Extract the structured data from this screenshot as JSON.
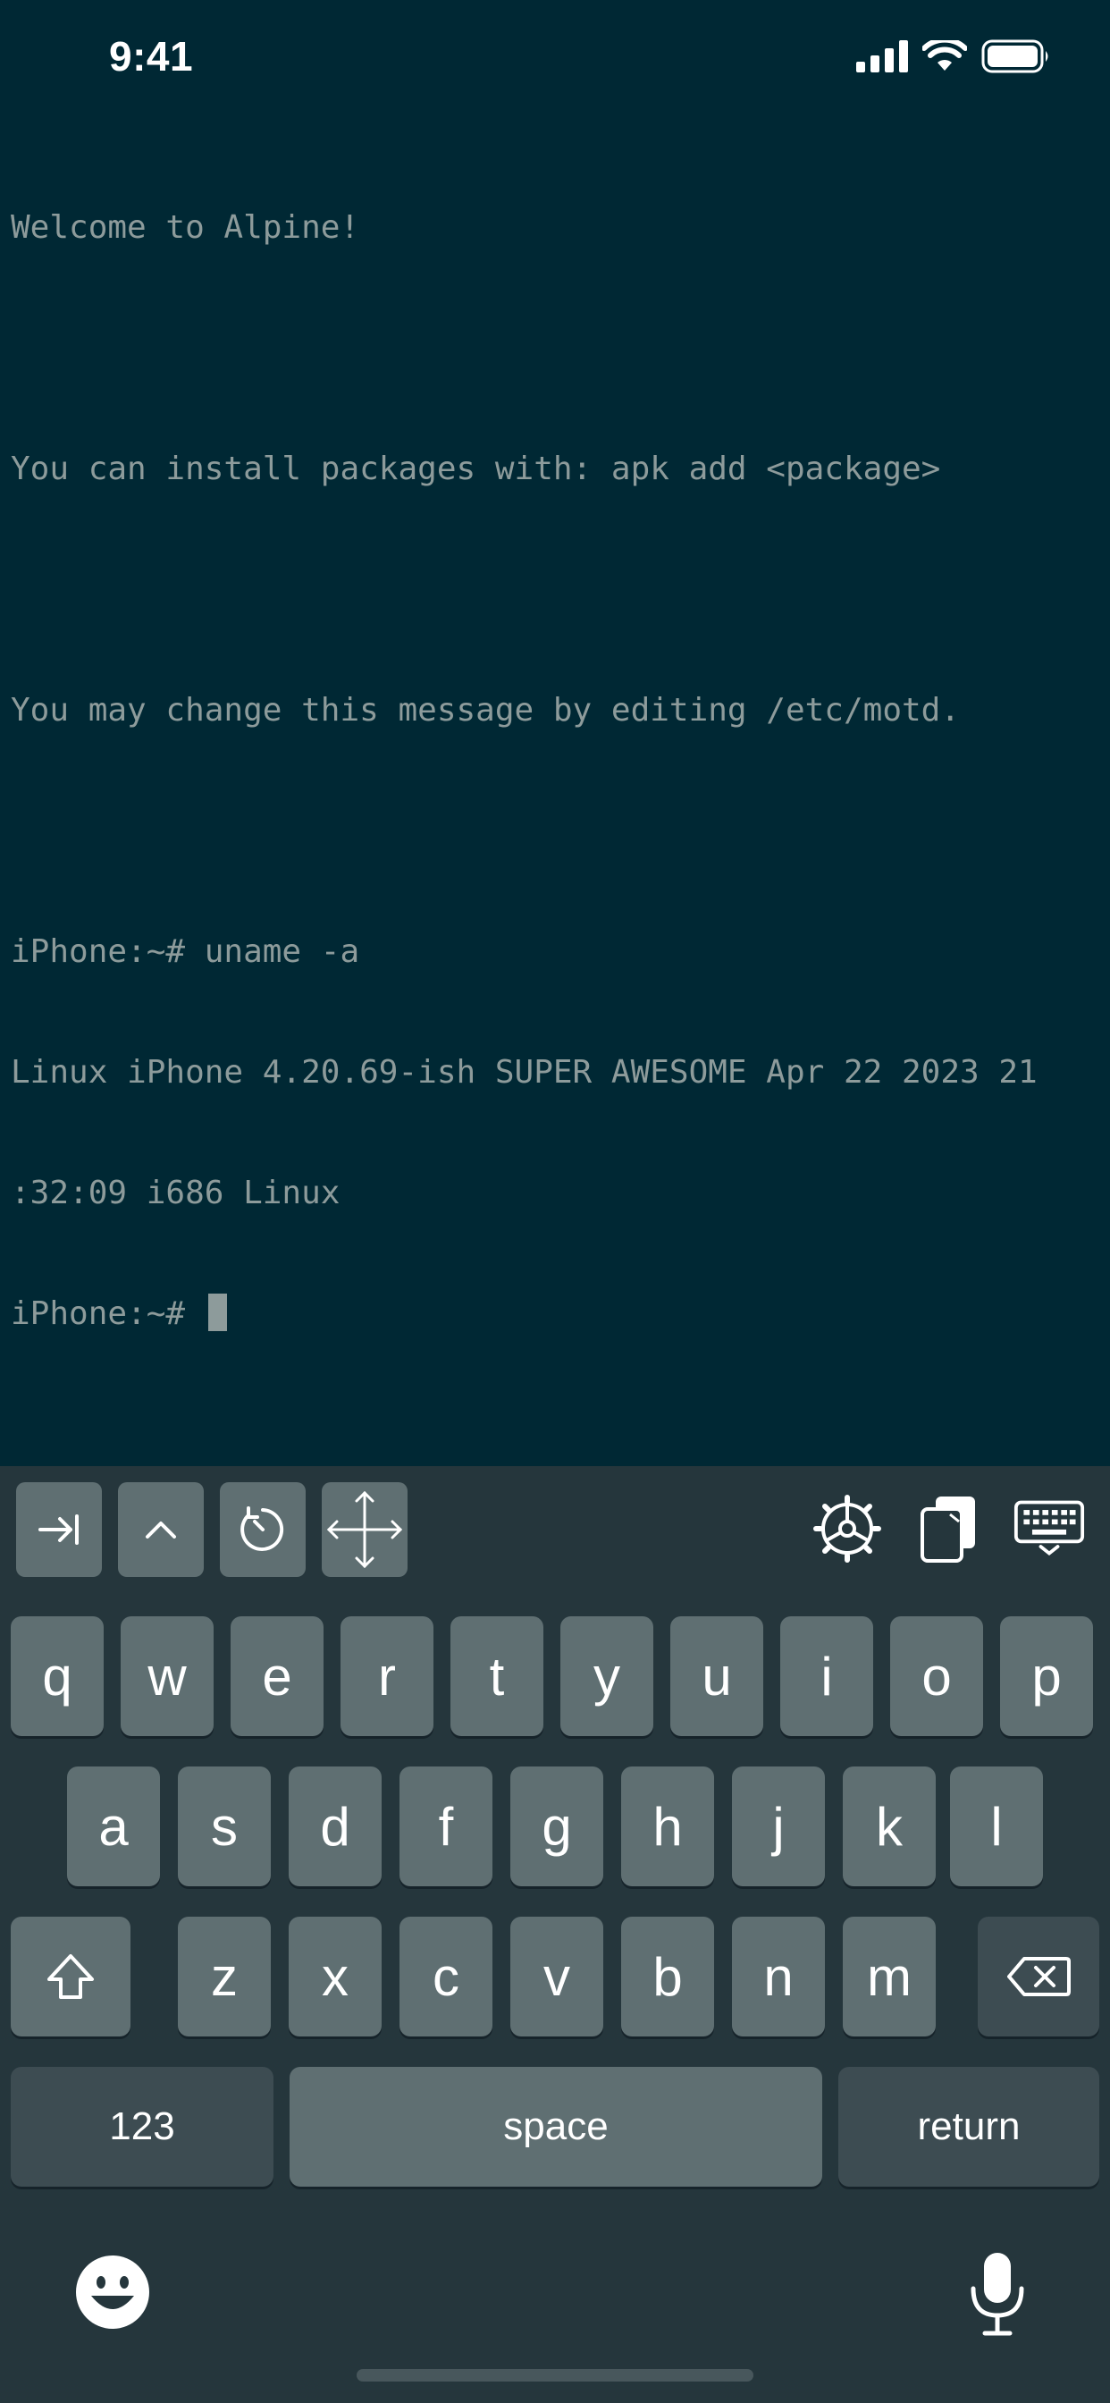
{
  "status_bar": {
    "time": "9:41",
    "icons": [
      "cellular-signal-icon",
      "wifi-icon",
      "battery-icon"
    ]
  },
  "terminal": {
    "lines": [
      "Welcome to Alpine!",
      "",
      "You can install packages with: apk add <package>",
      "",
      "You may change this message by editing /etc/motd.",
      "",
      "iPhone:~# uname -a",
      "Linux iPhone 4.20.69-ish SUPER AWESOME Apr 22 2023 21",
      ":32:09 i686 Linux"
    ],
    "prompt": "iPhone:~# "
  },
  "toolbar": {
    "left": [
      "tab-icon",
      "control-icon",
      "history-icon",
      "move-arrows-icon"
    ],
    "right": [
      "settings-gear-icon",
      "paste-icon",
      "hide-keyboard-icon"
    ]
  },
  "keyboard": {
    "row1": [
      "q",
      "w",
      "e",
      "r",
      "t",
      "y",
      "u",
      "i",
      "o",
      "p"
    ],
    "row2": [
      "a",
      "s",
      "d",
      "f",
      "g",
      "h",
      "j",
      "k",
      "l"
    ],
    "row3": [
      "z",
      "x",
      "c",
      "v",
      "b",
      "n",
      "m"
    ],
    "numbers_label": "123",
    "space_label": "space",
    "return_label": "return",
    "icons": [
      "shift-icon",
      "delete-icon",
      "emoji-icon",
      "microphone-icon"
    ]
  },
  "colors": {
    "terminal_background": "#002834",
    "terminal_text": "#8d9b9b",
    "keyboard_background": "#25363c",
    "key_background": "#5f6f72",
    "function_key_background": "#3d4c52"
  }
}
